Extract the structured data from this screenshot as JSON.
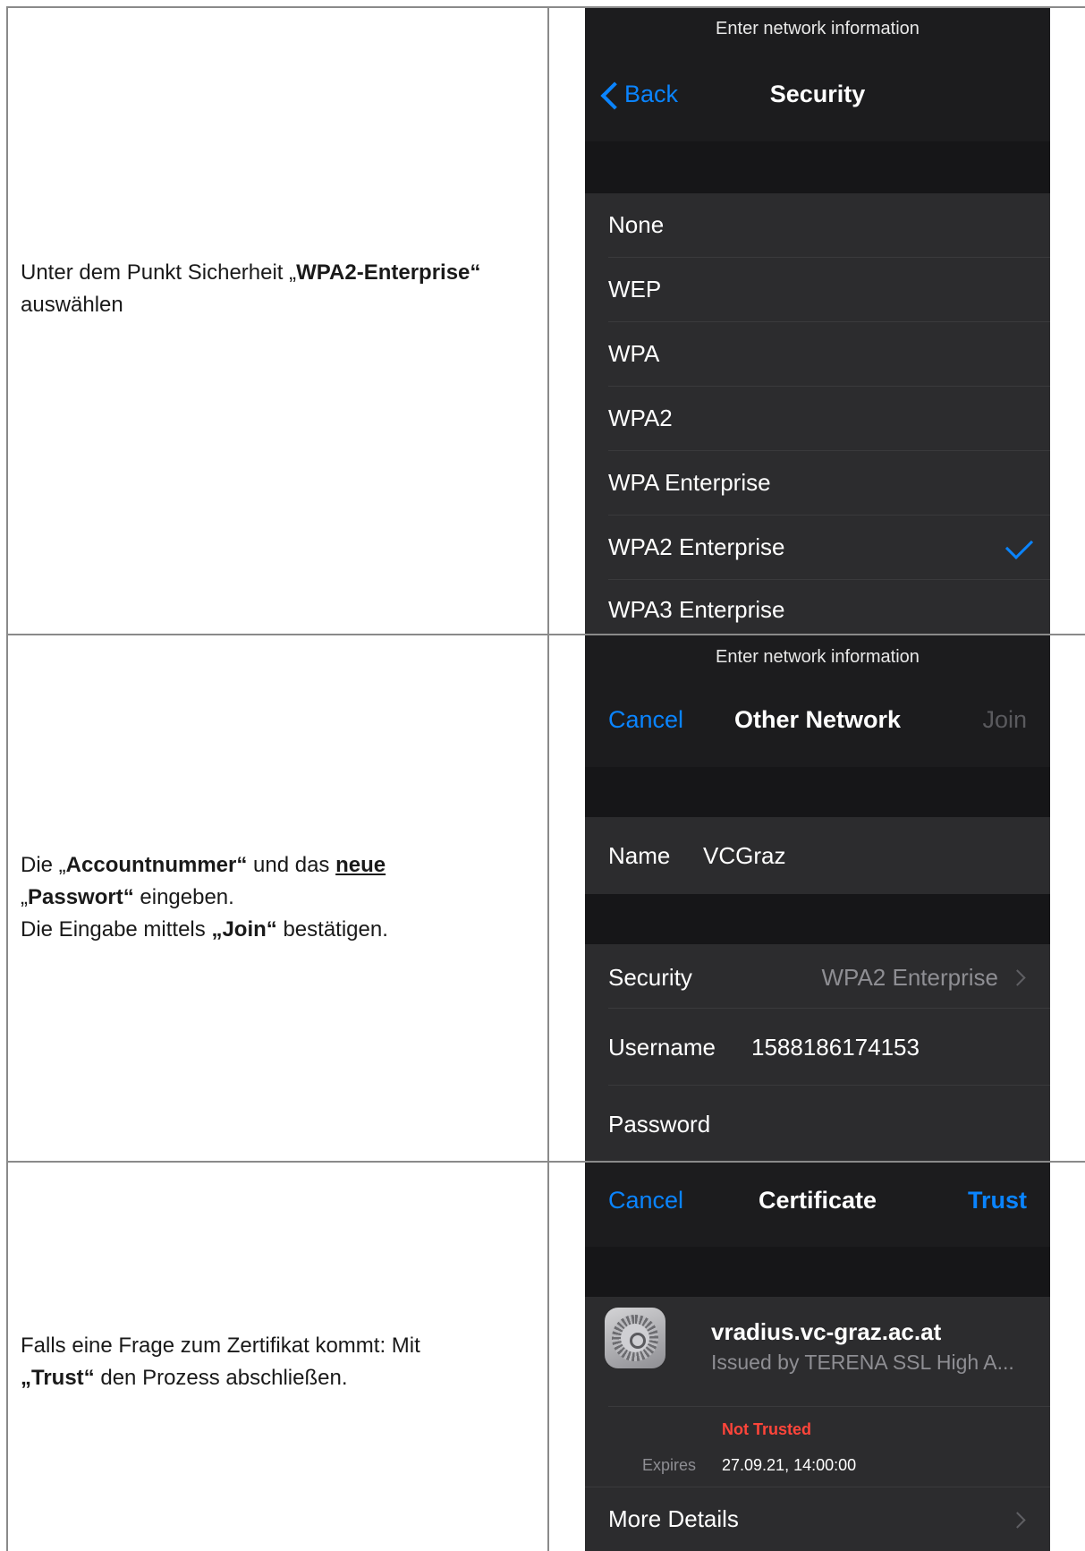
{
  "steps": [
    {
      "instruction": {
        "prefix": "Unter dem Punkt Sicherheit „",
        "bold": "WPA2-Enterprise“",
        "line2": "auswählen"
      },
      "screen": {
        "status_hint": "Enter network information",
        "back_label": "Back",
        "title": "Security",
        "options": [
          "None",
          "WEP",
          "WPA",
          "WPA2",
          "WPA Enterprise",
          "WPA2 Enterprise",
          "WPA3 Enterprise"
        ],
        "selected": "WPA2 Enterprise"
      }
    },
    {
      "instruction": {
        "l1_prefix": "Die „",
        "l1_bold": "Accountnummer“",
        "l1_mid": " und das ",
        "l1_underline": "neue",
        "l2_open": "„",
        "l2_bold": "Passwort“",
        "l2_rest": " eingeben.",
        "l3_prefix": "Die Eingabe mittels ",
        "l3_bold": "„Join“",
        "l3_rest": " bestätigen."
      },
      "screen": {
        "status_hint": "Enter network information",
        "cancel_label": "Cancel",
        "title": "Other Network",
        "join_label": "Join",
        "name_label": "Name",
        "name_value": "VCGraz",
        "security_label": "Security",
        "security_value": "WPA2 Enterprise",
        "username_label": "Username",
        "username_value": "1588186174153",
        "password_label": "Password"
      }
    },
    {
      "instruction": {
        "l1": "Falls eine Frage zum Zertifikat kommt: Mit",
        "l2_bold": "„Trust“",
        "l2_rest": " den Prozess abschließen."
      },
      "screen": {
        "cancel_label": "Cancel",
        "title": "Certificate",
        "trust_label": "Trust",
        "cert_name": "vradius.vc-graz.ac.at",
        "cert_issuer": "Issued by TERENA SSL High A...",
        "status": "Not Trusted",
        "expires_label": "Expires",
        "expires_value": "27.09.21, 14:00:00",
        "more_details": "More Details"
      }
    }
  ],
  "colors": {
    "accent": "#0a84ff",
    "danger": "#ff453a",
    "panel_bg": "#1c1c1e",
    "cell_bg": "#2c2c2e"
  },
  "icons": [
    "chevron-left-icon",
    "checkmark-icon",
    "chevron-right-icon",
    "settings-gear-icon"
  ]
}
